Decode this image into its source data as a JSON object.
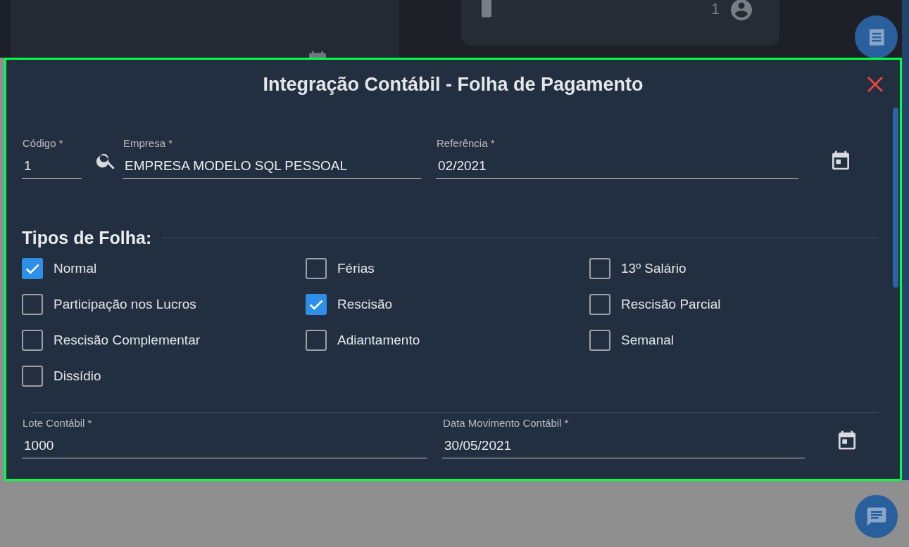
{
  "background": {
    "user_count": "1"
  },
  "dialog": {
    "title": "Integração Contábil - Folha de Pagamento",
    "fields_top": [
      {
        "kind": "code",
        "label": "Código *",
        "value": "1"
      },
      {
        "kind": "text",
        "label": "Empresa *",
        "value": "EMPRESA MODELO SQL PESSOAL"
      },
      {
        "kind": "date",
        "label": "Referência *",
        "value": "02/2021"
      }
    ],
    "section_title": "Tipos de Folha:",
    "payroll_types": [
      {
        "label": "Normal",
        "checked": true
      },
      {
        "label": "Férias",
        "checked": false
      },
      {
        "label": "13º Salário",
        "checked": false
      },
      {
        "label": "Participação nos Lucros",
        "checked": false
      },
      {
        "label": "Rescisão",
        "checked": true
      },
      {
        "label": "Rescisão Parcial",
        "checked": false
      },
      {
        "label": "Rescisão Complementar",
        "checked": false
      },
      {
        "label": "Adiantamento",
        "checked": false
      },
      {
        "label": "Semanal",
        "checked": false
      },
      {
        "label": "Dissídio",
        "checked": false
      }
    ],
    "fields_bottom": [
      {
        "kind": "text",
        "label": "Lote Contábil *",
        "value": "1000"
      },
      {
        "kind": "date",
        "label": "Data Movimento Contábil *",
        "value": "30/05/2021"
      }
    ]
  }
}
